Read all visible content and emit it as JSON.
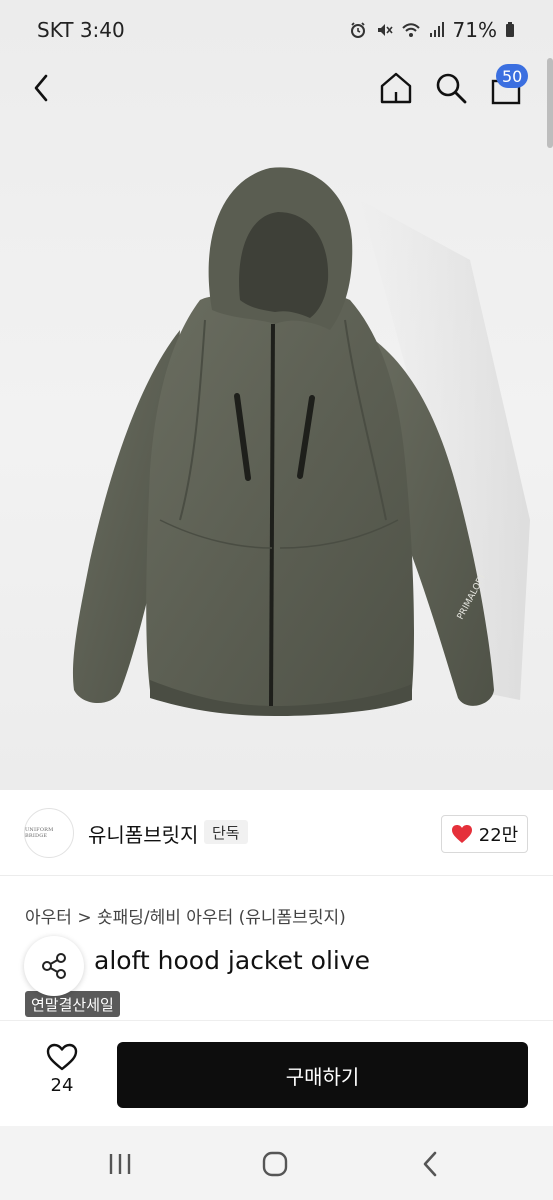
{
  "status_bar": {
    "carrier_time": "SKT 3:40",
    "battery": "71%"
  },
  "nav": {
    "cart_count": "50"
  },
  "product_image": {
    "print_text": "PRIMALOFT"
  },
  "store": {
    "logo_text": "UNIFORM BRIDGE",
    "name": "유니폼브릿지",
    "tag": "단독",
    "likes": "22만"
  },
  "breadcrumb": "아우터 > 숏패딩/헤비 아우터 (유니폼브릿지)",
  "product": {
    "title": "aloft hood jacket olive",
    "sale_badge": "연말결산세일"
  },
  "buy_bar": {
    "wish_count": "24",
    "buy_label": "구매하기"
  },
  "colors": {
    "accent_badge": "#3b6fe0",
    "heart": "#e5303a",
    "buy_button": "#0d0d0d",
    "jacket": "#5e6154"
  }
}
